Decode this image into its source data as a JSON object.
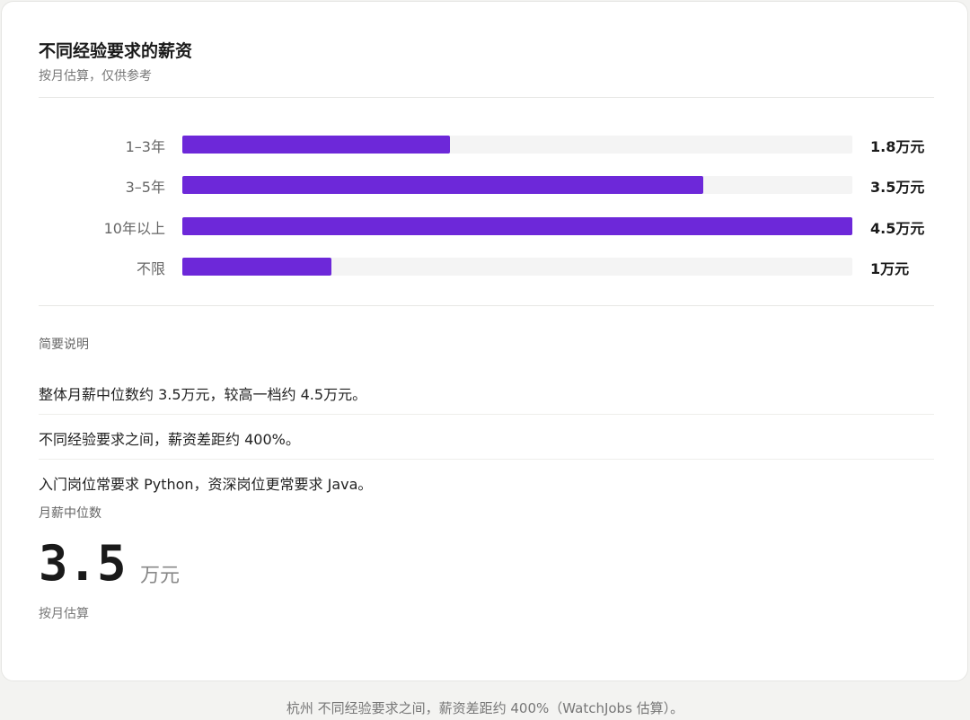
{
  "card": {
    "title": "不同经验要求的薪资",
    "subtitle": "按月估算，仅供参考"
  },
  "chart_data": {
    "type": "bar",
    "orientation": "horizontal",
    "categories": [
      "1–3年",
      "3–5年",
      "10年以上",
      "不限"
    ],
    "values": [
      1.8,
      3.5,
      4.5,
      1
    ],
    "value_labels": [
      "1.8万元",
      "3.5万元",
      "4.5万元",
      "1万元"
    ],
    "xlim": [
      0,
      4.5
    ],
    "unit": "万元",
    "grid": false,
    "bar_color": "#6d28d9",
    "track_color": "#f4f4f4"
  },
  "notes": {
    "label": "简要说明",
    "items": [
      "整体月薪中位数约 3.5万元，较高一档约 4.5万元。",
      "不同经验要求之间，薪资差距约 400%。",
      "入门岗位常要求 Python，资深岗位更常要求 Java。"
    ]
  },
  "metric": {
    "label": "月薪中位数",
    "value": "3.5",
    "unit": "万元",
    "note": "按月估算"
  },
  "footer": {
    "text": "杭州 不同经验要求之间，薪资差距约 400%（WatchJobs 估算）。"
  }
}
